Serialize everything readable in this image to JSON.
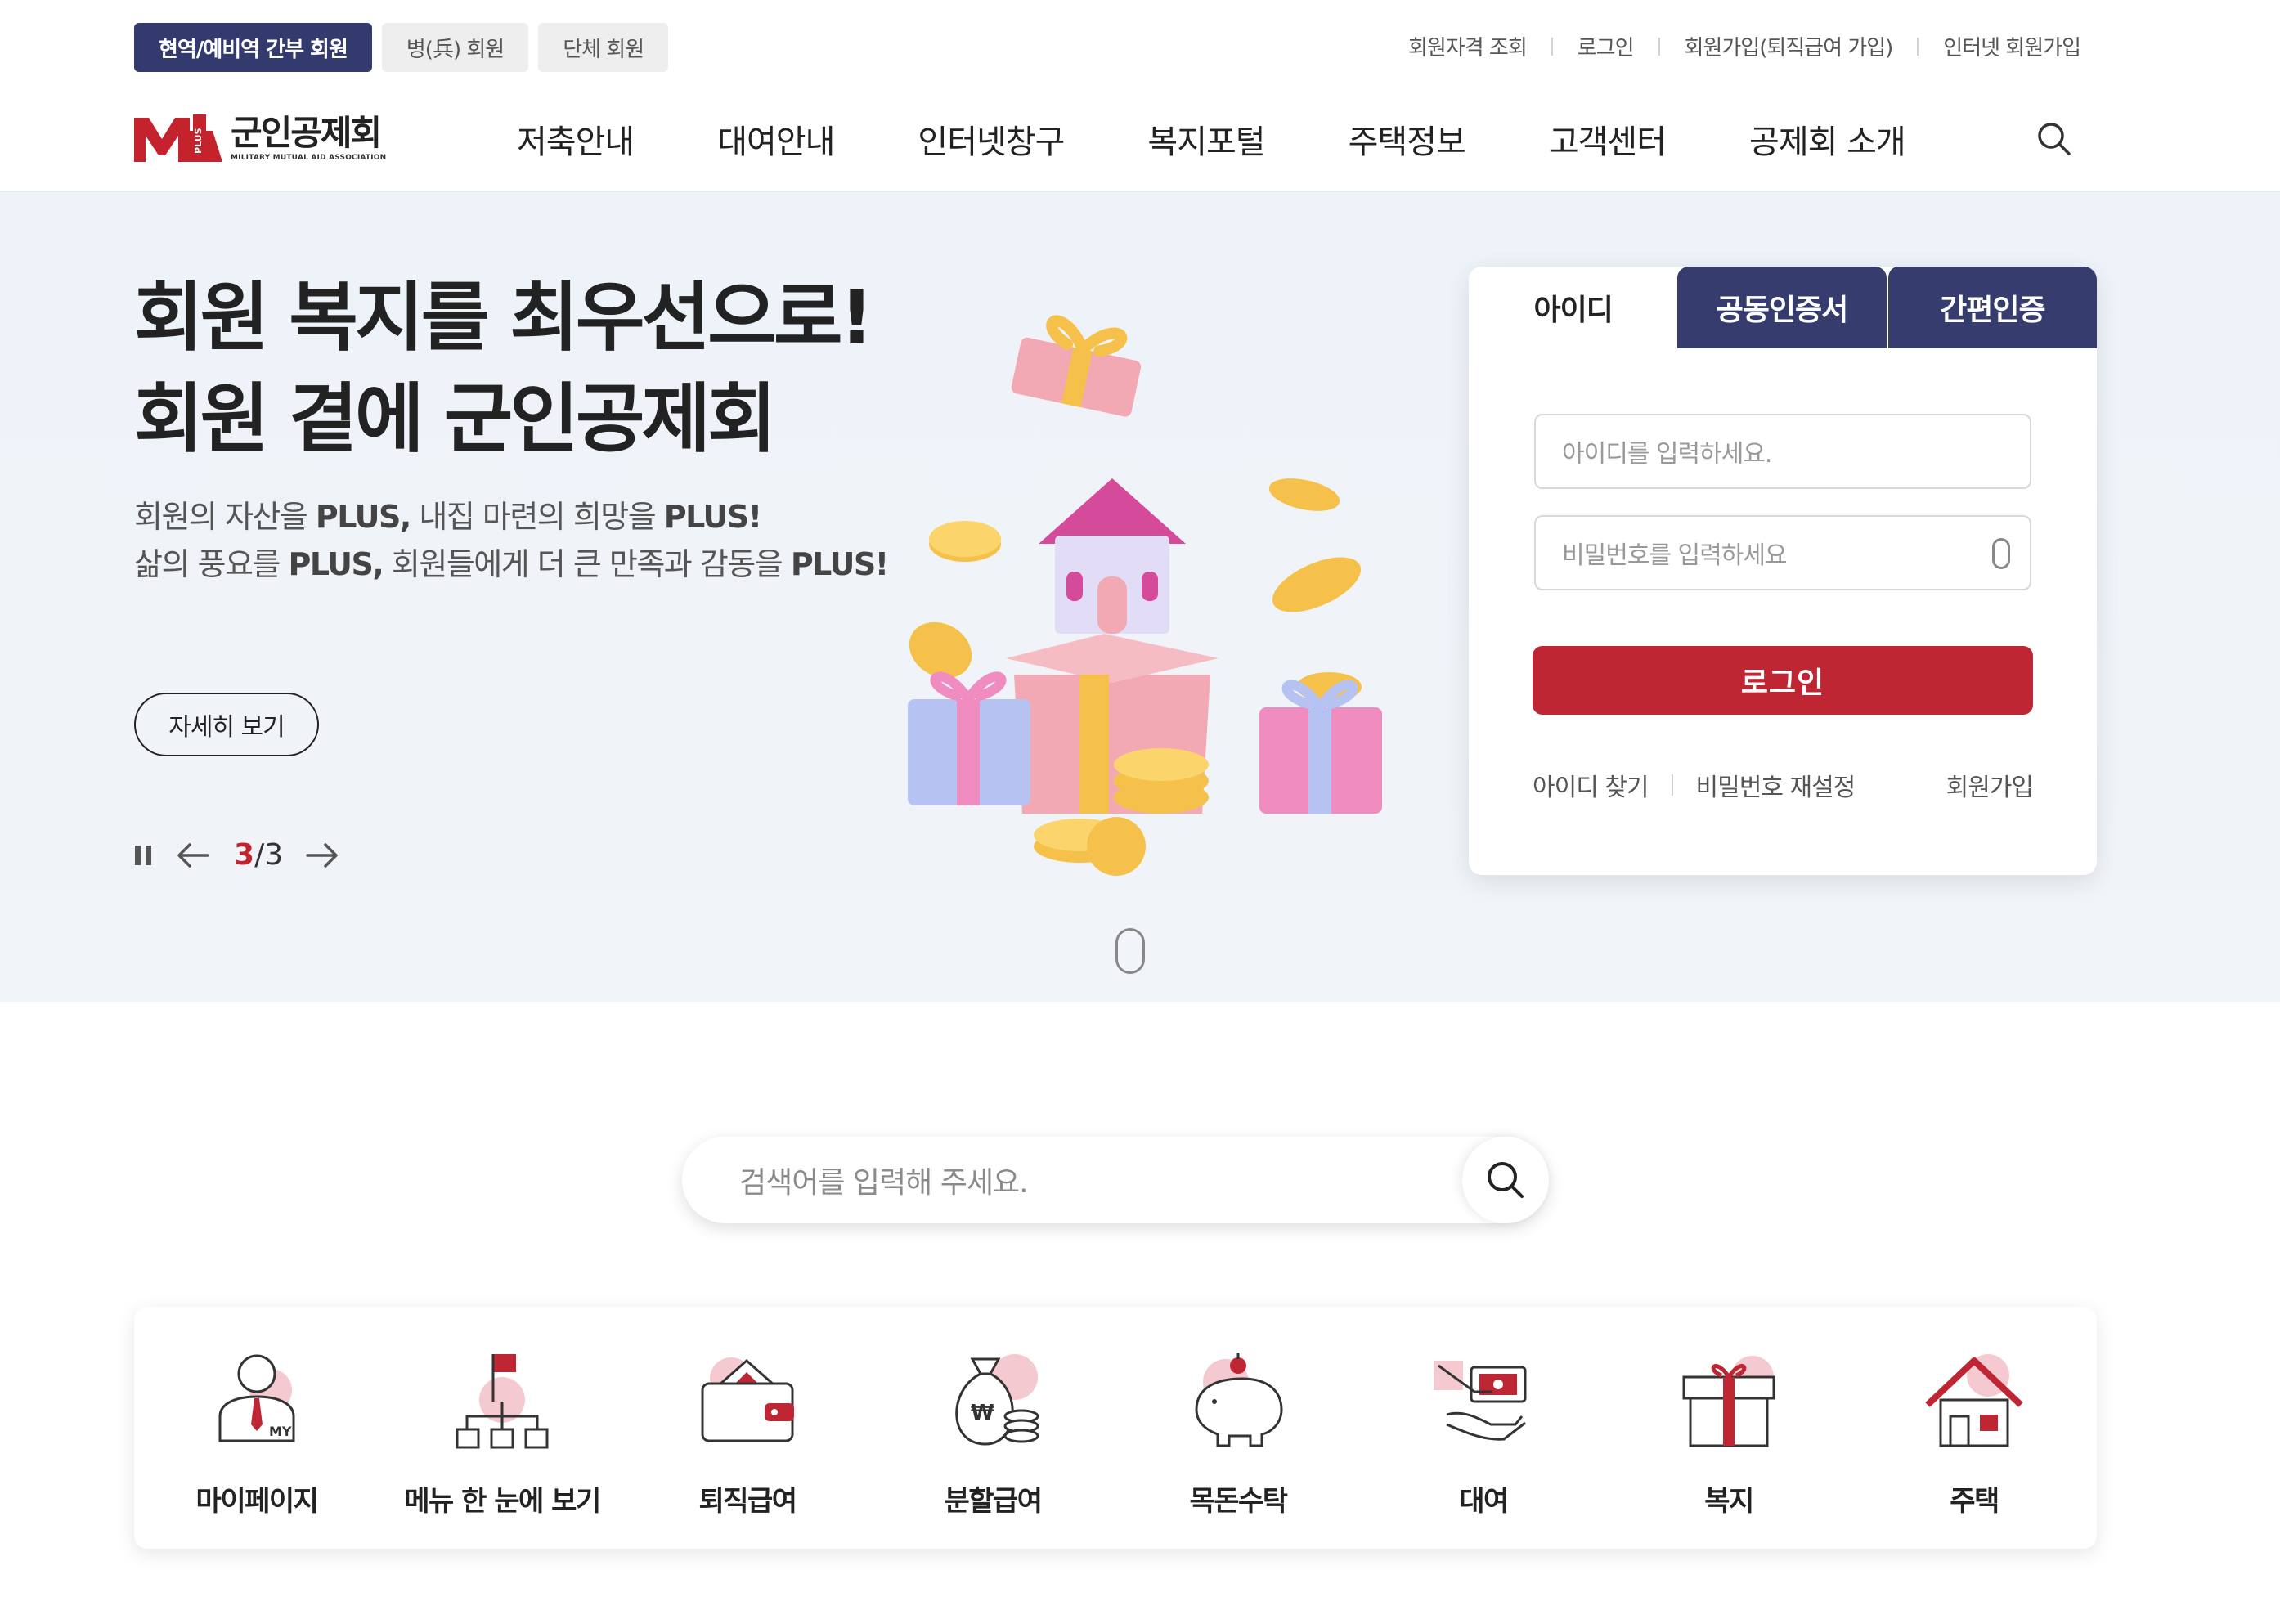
{
  "member_tabs": [
    {
      "label": "현역/예비역 간부 회원",
      "active": true
    },
    {
      "label": "병(兵) 회원",
      "active": false
    },
    {
      "label": "단체 회원",
      "active": false
    }
  ],
  "util_links": [
    "회원자격 조회",
    "로그인",
    "회원가입(퇴직급여 가입)",
    "인터넷 회원가입"
  ],
  "logo": {
    "name": "군인공제회",
    "sub": "MILITARY MUTUAL AID ASSOCIATION",
    "badge": "PLUS"
  },
  "gnb": [
    "저축안내",
    "대여안내",
    "인터넷창구",
    "복지포털",
    "주택정보",
    "고객센터",
    "공제회 소개"
  ],
  "hero": {
    "title_line1_bold": "회원 복지",
    "title_line1_rest": "를 최우선으로!",
    "title_line2_rest": "회원 곁에 ",
    "title_line2_bold": "군인공제회",
    "sub_line1": {
      "p1": "회원의 자산을 ",
      "b1": "PLUS,",
      "p2": " 내집 마련의 희망을 ",
      "b2": "PLUS!"
    },
    "sub_line2": {
      "p1": "삶의 풍요를 ",
      "b1": "PLUS,",
      "p2": " 회원들에게 더 큰 만족과 감동을 ",
      "b2": "PLUS!"
    },
    "more_label": "자세히 보기",
    "pager_current": "3",
    "pager_total": "3"
  },
  "login": {
    "tabs": [
      {
        "label": "아이디",
        "active": true
      },
      {
        "label": "공동인증서",
        "active": false
      },
      {
        "label": "간편인증",
        "active": false
      }
    ],
    "id_placeholder": "아이디를 입력하세요.",
    "pw_placeholder": "비밀번호를 입력하세요",
    "button": "로그인",
    "find_id": "아이디 찾기",
    "reset_pw": "비밀번호 재설정",
    "join": "회원가입"
  },
  "search": {
    "placeholder": "검색어를 입력해 주세요."
  },
  "quick_menu": [
    {
      "label": "마이페이지",
      "icon": "my-page-icon"
    },
    {
      "label": "메뉴 한 눈에 보기",
      "icon": "sitemap-icon"
    },
    {
      "label": "퇴직급여",
      "icon": "wallet-icon"
    },
    {
      "label": "분할급여",
      "icon": "money-bag-icon"
    },
    {
      "label": "목돈수탁",
      "icon": "piggy-bank-icon"
    },
    {
      "label": "대여",
      "icon": "loan-hand-icon"
    },
    {
      "label": "복지",
      "icon": "gift-icon"
    },
    {
      "label": "주택",
      "icon": "house-icon"
    }
  ],
  "colors": {
    "navy": "#333b6e",
    "brand_red": "#be2634",
    "accent_pink": "#f4c9d0"
  }
}
